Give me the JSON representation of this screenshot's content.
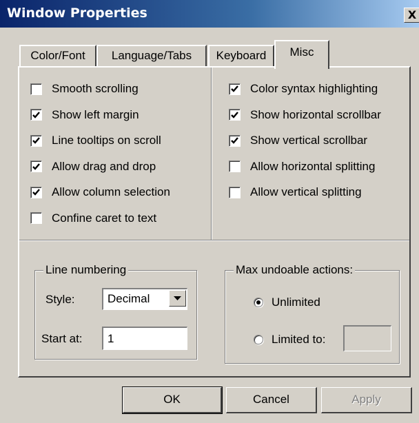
{
  "window": {
    "title": "Window Properties",
    "close_label": "X"
  },
  "tabs": [
    {
      "label": "Color/Font",
      "active": false
    },
    {
      "label": "Language/Tabs",
      "active": false
    },
    {
      "label": "Keyboard",
      "active": false
    },
    {
      "label": "Misc",
      "active": true
    }
  ],
  "left_options": [
    {
      "label": "Smooth scrolling",
      "checked": false
    },
    {
      "label": "Show left margin",
      "checked": true
    },
    {
      "label": "Line tooltips on scroll",
      "checked": true
    },
    {
      "label": "Allow drag and drop",
      "checked": true
    },
    {
      "label": "Allow column selection",
      "checked": true
    },
    {
      "label": "Confine caret to text",
      "checked": false
    }
  ],
  "right_options": [
    {
      "label": "Color syntax highlighting",
      "checked": true
    },
    {
      "label": "Show horizontal scrollbar",
      "checked": true
    },
    {
      "label": "Show vertical scrollbar",
      "checked": true
    },
    {
      "label": "Allow horizontal splitting",
      "checked": false
    },
    {
      "label": "Allow vertical splitting",
      "checked": false
    }
  ],
  "line_numbering": {
    "legend": "Line numbering",
    "style_label": "Style:",
    "style_value": "Decimal",
    "start_label": "Start at:",
    "start_value": "1"
  },
  "undo": {
    "legend": "Max undoable actions:",
    "unlimited_label": "Unlimited",
    "unlimited_selected": true,
    "limited_label": "Limited to:",
    "limited_selected": false,
    "limited_value": ""
  },
  "buttons": {
    "ok": "OK",
    "cancel": "Cancel",
    "apply": "Apply"
  },
  "colors": {
    "dialog_bg": "#d4d0c8",
    "title_start": "#0a246a",
    "title_end": "#a6caf0"
  }
}
